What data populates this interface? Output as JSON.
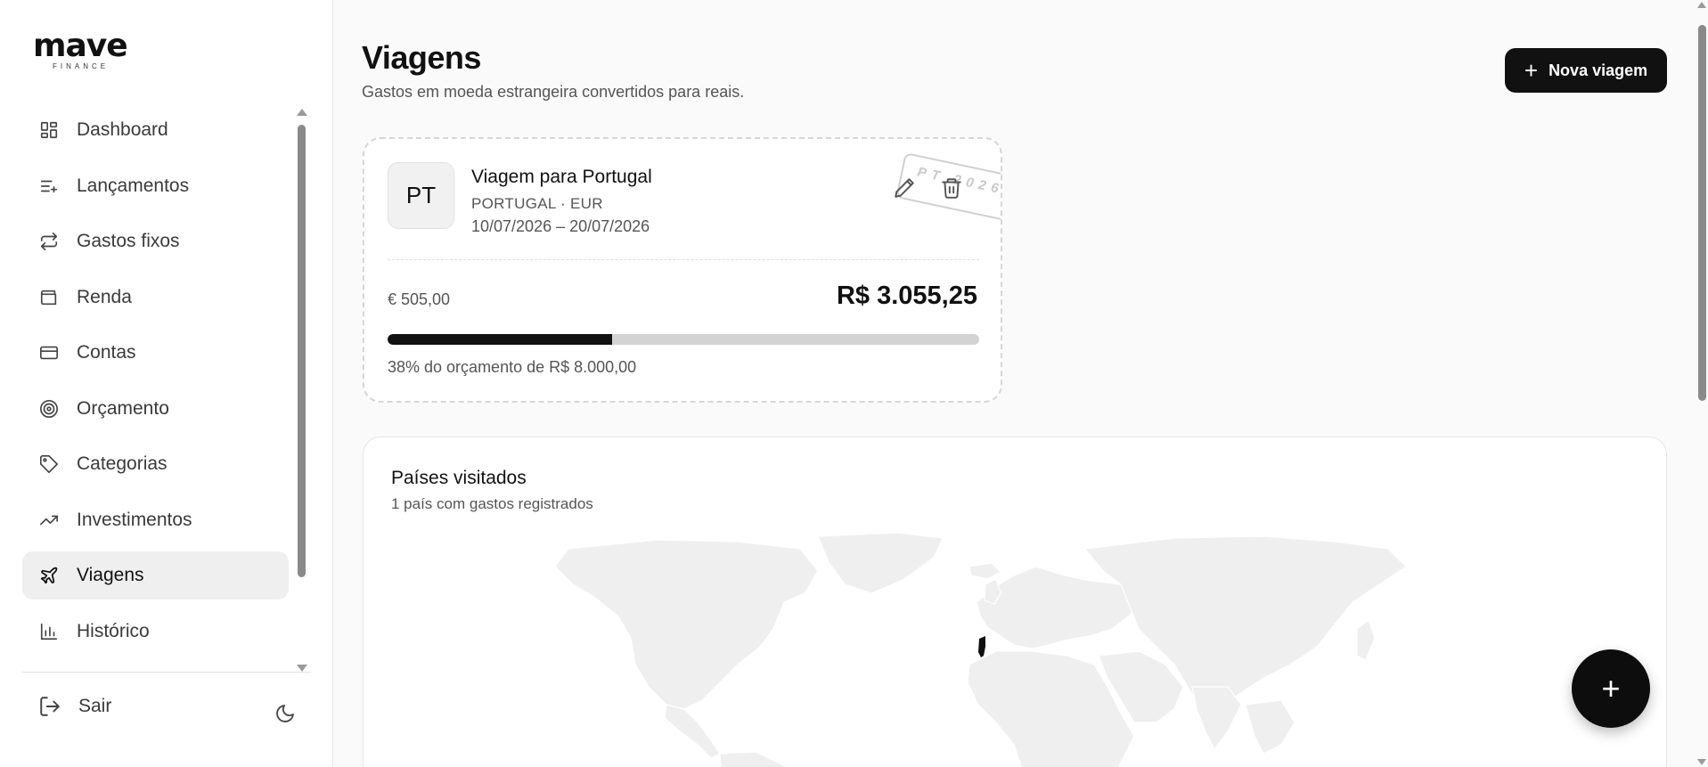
{
  "brand": {
    "name": "mave",
    "tagline": "FINANCE"
  },
  "sidebar": {
    "items": [
      {
        "label": "Dashboard",
        "icon": "dashboard-icon",
        "active": false
      },
      {
        "label": "Lançamentos",
        "icon": "list-plus-icon",
        "active": false
      },
      {
        "label": "Gastos fixos",
        "icon": "repeat-icon",
        "active": false
      },
      {
        "label": "Renda",
        "icon": "wallet-icon",
        "active": false
      },
      {
        "label": "Contas",
        "icon": "credit-card-icon",
        "active": false
      },
      {
        "label": "Orçamento",
        "icon": "target-icon",
        "active": false
      },
      {
        "label": "Categorias",
        "icon": "tag-icon",
        "active": false
      },
      {
        "label": "Investimentos",
        "icon": "trending-up-icon",
        "active": false
      },
      {
        "label": "Viagens",
        "icon": "plane-icon",
        "active": true
      },
      {
        "label": "Histórico",
        "icon": "bar-chart-icon",
        "active": false
      }
    ],
    "logout_label": "Sair"
  },
  "header": {
    "title": "Viagens",
    "subtitle": "Gastos em moeda estrangeira convertidos para reais.",
    "new_trip_label": "Nova viagem"
  },
  "trip": {
    "code": "PT",
    "name": "Viagem para Portugal",
    "country_currency": "PORTUGAL · EUR",
    "dates": "10/07/2026 – 20/07/2026",
    "stamp_text": "PT 2026",
    "foreign_amount": "€ 505,00",
    "brl_amount": "R$ 3.055,25",
    "budget_progress": 0.38,
    "budget_text": "38% do orçamento de R$ 8.000,00"
  },
  "countries": {
    "title": "Países visitados",
    "subtitle": "1 país com gastos registrados",
    "highlighted": [
      "Portugal"
    ]
  },
  "colors": {
    "accent": "#111111",
    "background": "#fafafa",
    "map_land": "#efefef",
    "progress_track": "#d3d3d3"
  }
}
